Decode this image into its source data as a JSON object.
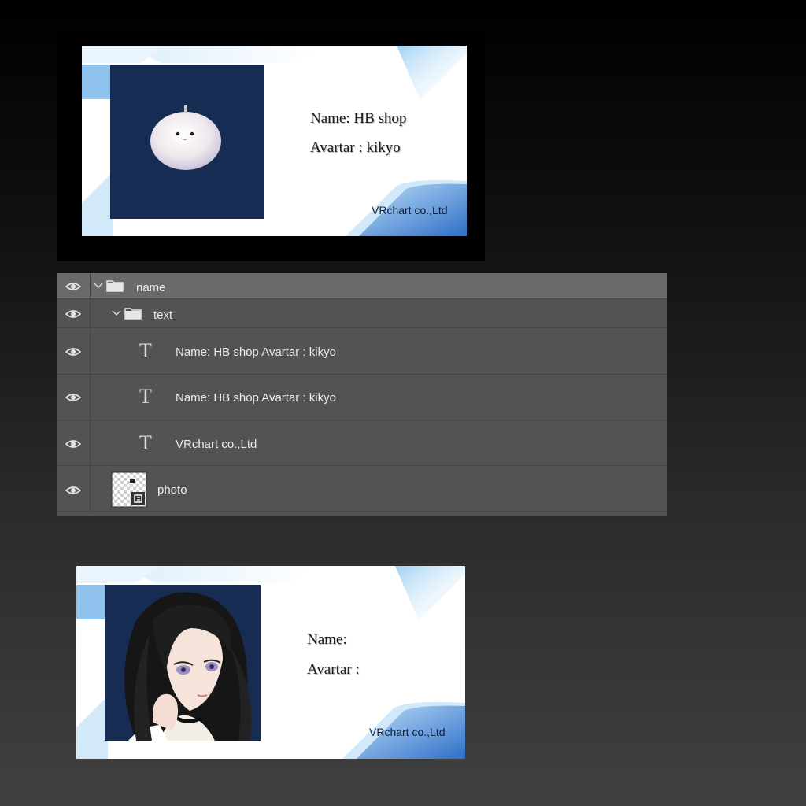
{
  "card_top": {
    "name_line": "Name: HB shop",
    "avatar_line": "Avartar : kikyo",
    "company": "VRchart co.,Ltd"
  },
  "layers_panel": {
    "rows": [
      {
        "label": "name",
        "kind": "group",
        "icon": "folder-icon",
        "expanded": true
      },
      {
        "label": "text",
        "kind": "group",
        "icon": "folder-icon",
        "expanded": true
      },
      {
        "label": "Name: HB shop Avartar : kikyo",
        "kind": "text-layer",
        "icon": "type-icon"
      },
      {
        "label": "Name: HB shop Avartar : kikyo",
        "kind": "text-layer",
        "icon": "type-icon"
      },
      {
        "label": "VRchart co.,Ltd",
        "kind": "text-layer",
        "icon": "type-icon"
      },
      {
        "label": "photo",
        "kind": "smart-object",
        "icon": "layer-thumbnail"
      }
    ],
    "visibility_icon": "eye-icon"
  },
  "card_bottom": {
    "name_line": "Name:",
    "avatar_line": "Avartar :",
    "company": "VRchart co.,Ltd"
  },
  "colors": {
    "card_photo_bg": "#162c53",
    "accent_blue": "#3f86d6",
    "panel_bg": "#535353",
    "panel_highlight": "#6a6a6a"
  }
}
